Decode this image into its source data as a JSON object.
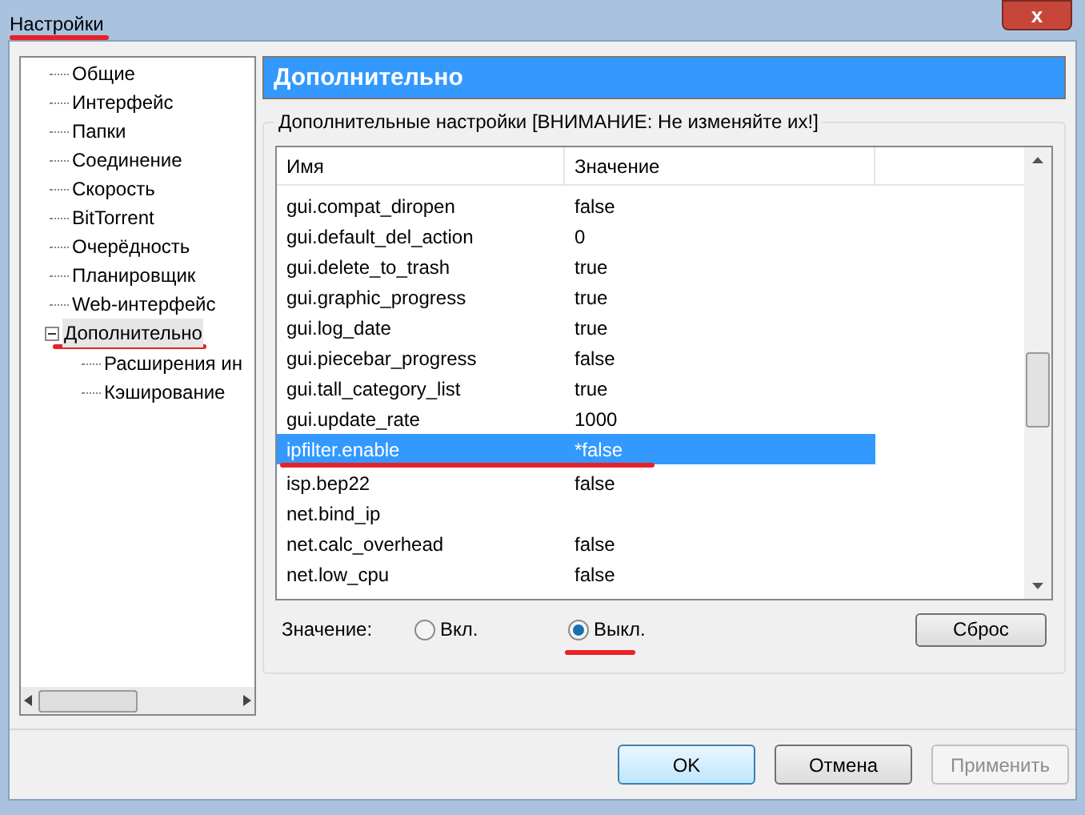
{
  "window": {
    "title": "Настройки",
    "close": "x"
  },
  "sidebar": {
    "items": [
      {
        "label": "Общие",
        "selected": false
      },
      {
        "label": "Интерфейс",
        "selected": false
      },
      {
        "label": "Папки",
        "selected": false
      },
      {
        "label": "Соединение",
        "selected": false
      },
      {
        "label": "Скорость",
        "selected": false
      },
      {
        "label": "BitTorrent",
        "selected": false
      },
      {
        "label": "Очерёдность",
        "selected": false
      },
      {
        "label": "Планировщик",
        "selected": false
      },
      {
        "label": "Web-интерфейс",
        "selected": false
      },
      {
        "label": "Дополнительно",
        "selected": true,
        "expanded": true,
        "children": [
          {
            "label": "Расширения ин",
            "selected": false
          },
          {
            "label": "Кэширование",
            "selected": false
          }
        ]
      }
    ]
  },
  "header": {
    "title": "Дополнительно"
  },
  "group": {
    "title": "Дополнительные настройки [ВНИМАНИЕ: Не изменяйте их!]"
  },
  "table": {
    "columns": [
      "Имя",
      "Значение"
    ],
    "rows": [
      {
        "name": "gui.compat_diropen",
        "value": "false",
        "selected": false
      },
      {
        "name": "gui.default_del_action",
        "value": "0",
        "selected": false
      },
      {
        "name": "gui.delete_to_trash",
        "value": "true",
        "selected": false
      },
      {
        "name": "gui.graphic_progress",
        "value": "true",
        "selected": false
      },
      {
        "name": "gui.log_date",
        "value": "true",
        "selected": false
      },
      {
        "name": "gui.piecebar_progress",
        "value": "false",
        "selected": false
      },
      {
        "name": "gui.tall_category_list",
        "value": "true",
        "selected": false
      },
      {
        "name": "gui.update_rate",
        "value": "1000",
        "selected": false
      },
      {
        "name": "ipfilter.enable",
        "value": "*false",
        "selected": true
      },
      {
        "name": "isp.bep22",
        "value": "false",
        "selected": false
      },
      {
        "name": "net.bind_ip",
        "selected": false
      },
      {
        "name": "net.calc_overhead",
        "value": "false",
        "selected": false
      },
      {
        "name": "net.low_cpu",
        "value": "false",
        "selected": false
      }
    ]
  },
  "value_editor": {
    "label": "Значение:",
    "options": [
      {
        "label": "Вкл.",
        "selected": false
      },
      {
        "label": "Выкл.",
        "selected": true
      }
    ],
    "reset_button": "Сброс"
  },
  "buttons": [
    {
      "label": "OK",
      "disabled": false,
      "default": true
    },
    {
      "label": "Отмена",
      "disabled": false,
      "default": false
    },
    {
      "label": "Применить",
      "disabled": true,
      "default": false
    }
  ]
}
